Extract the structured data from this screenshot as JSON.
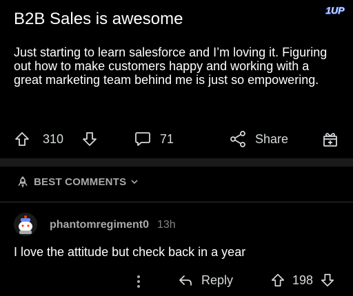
{
  "post": {
    "title": "B2B Sales is awesome",
    "body": "Just starting to learn salesforce and I’m loving it. Figuring out how to make customers happy and working with a great marketing team behind me is just so empowering.",
    "upvotes": "310",
    "comments": "71",
    "share_label": "Share"
  },
  "watermark": {
    "text": "1UP"
  },
  "sort": {
    "label": "BEST COMMENTS"
  },
  "comment": {
    "username": "phantomregiment0",
    "timestamp": "13h",
    "text": "I love the attitude but check back in a year",
    "reply_label": "Reply",
    "votes": "198"
  },
  "colors": {
    "background": "#000000",
    "text": "#ffffff",
    "muted": "#a8aaab",
    "divider": "#1a1a1b",
    "watermark": "#6b8cff"
  },
  "icons": [
    "upvote-icon",
    "downvote-icon",
    "comment-icon",
    "share-icon",
    "award-icon",
    "rocket-icon",
    "chevron-down-icon",
    "more-icon",
    "reply-icon"
  ]
}
